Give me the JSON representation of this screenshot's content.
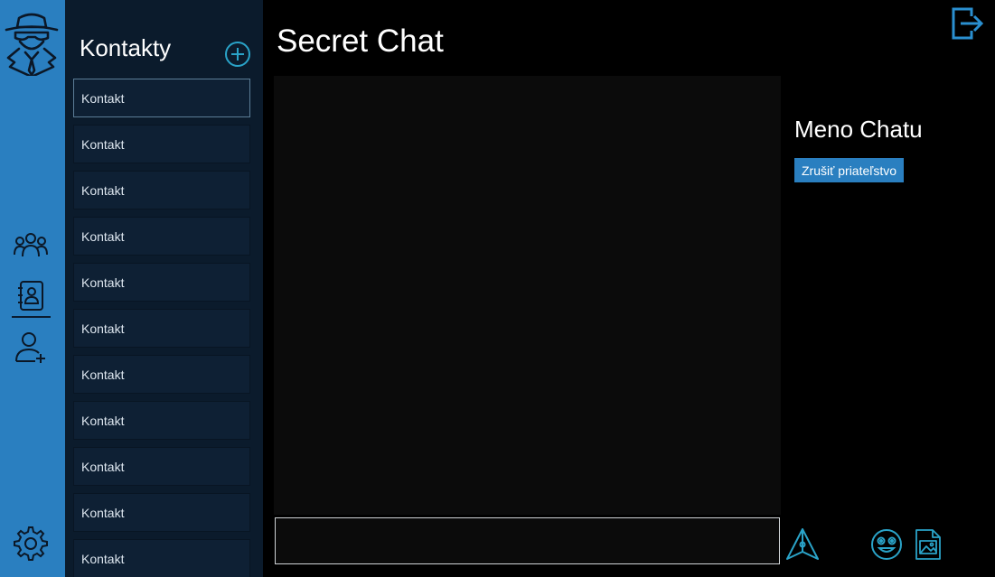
{
  "app": {
    "title": "Secret Chat"
  },
  "colors": {
    "rail": "#2a7fc0",
    "panel": "#0b1b2c",
    "accent": "#2aa3c8",
    "background": "#000000"
  },
  "icons": {
    "logo": "spy-logo-icon",
    "nav": [
      "groups-icon",
      "contacts-book-icon",
      "add-user-icon",
      "settings-icon"
    ],
    "add_contact": "plus-circle-icon",
    "logout": "logout-icon",
    "send": "send-icon",
    "emoji": "emoji-icon",
    "image": "image-file-icon"
  },
  "contacts": {
    "title": "Kontakty",
    "items": [
      "Kontakt",
      "Kontakt",
      "Kontakt",
      "Kontakt",
      "Kontakt",
      "Kontakt",
      "Kontakt",
      "Kontakt",
      "Kontakt",
      "Kontakt",
      "Kontakt"
    ]
  },
  "chat": {
    "name": "Meno Chatu",
    "unfriend_label": "Zrušiť priateľstvo",
    "input_value": ""
  }
}
